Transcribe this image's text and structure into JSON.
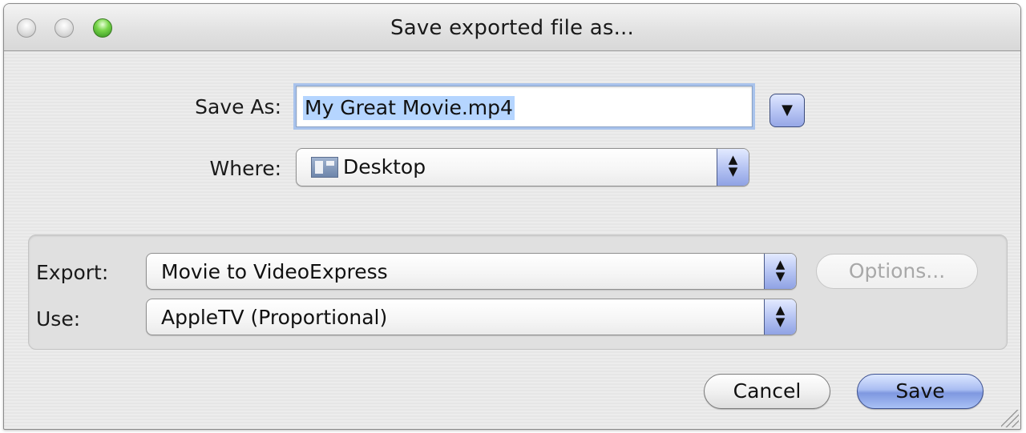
{
  "window": {
    "title": "Save exported file as..."
  },
  "save_as": {
    "label": "Save As:",
    "value": "My Great Movie.mp4",
    "disclosure_icon": "▼"
  },
  "where": {
    "label": "Where:",
    "value": "Desktop",
    "icon": "desktop-folder-icon"
  },
  "export": {
    "label": "Export:",
    "value": "Movie to VideoExpress",
    "options_label": "Options..."
  },
  "use": {
    "label": "Use:",
    "value": "AppleTV (Proportional)"
  },
  "buttons": {
    "cancel": "Cancel",
    "save": "Save"
  },
  "popup_arrows": "▲\n▼",
  "colors": {
    "accent": "#a9bdf2",
    "close_button": "#e4e4e4",
    "zoom_button": "#79d64b"
  }
}
